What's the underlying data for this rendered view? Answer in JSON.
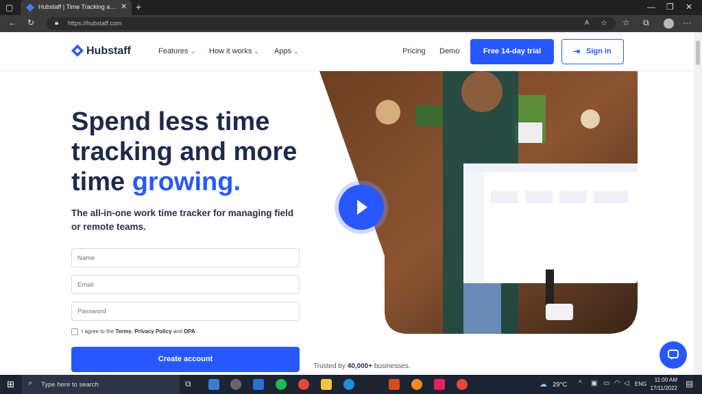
{
  "browser": {
    "tab_title": "Hubstaff | Time Tracking and Pro",
    "url": "https://hubstaff.com"
  },
  "nav": {
    "logo": "Hubstaff",
    "links": [
      "Features",
      "How it works",
      "Apps"
    ],
    "pricing": "Pricing",
    "demo": "Demo",
    "trial": "Free 14-day trial",
    "signin": "Sign in"
  },
  "hero": {
    "headline_part1": "Spend less time tracking and more time",
    "headline_highlight": "growing.",
    "subtext": "The all-in-one work time tracker for managing field or remote teams.",
    "name_placeholder": "Name",
    "email_placeholder": "Email",
    "password_placeholder": "Password",
    "agree_prefix": "I agree to the",
    "terms": "Terms",
    "privacy": "Privacy Policy",
    "and": "and",
    "dpa": "DPA",
    "create_button": "Create account",
    "trusted_prefix": "Trusted by",
    "trusted_count": "40,000+",
    "trusted_suffix": "businesses."
  },
  "taskbar": {
    "search_placeholder": "Type here to search",
    "weather": "29°C",
    "lang": "ENG",
    "time": "11:00 AM",
    "date": "17/11/2022"
  },
  "colors": {
    "accent": "#2758ff",
    "heading": "#1e2a4a"
  }
}
